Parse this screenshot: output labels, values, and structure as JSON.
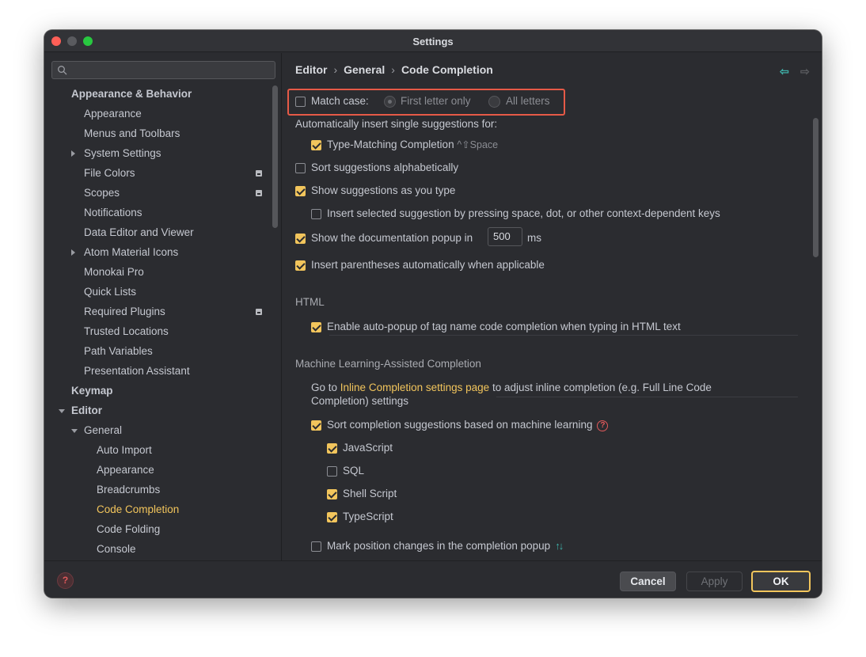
{
  "window": {
    "title": "Settings"
  },
  "sidebar": {
    "search_placeholder": "",
    "items": [
      {
        "label": "Appearance & Behavior",
        "level": 0,
        "bold": true
      },
      {
        "label": "Appearance",
        "level": 1
      },
      {
        "label": "Menus and Toolbars",
        "level": 1
      },
      {
        "label": "System Settings",
        "level": 1,
        "expander": "collapsed"
      },
      {
        "label": "File Colors",
        "level": 1,
        "project_icon": true
      },
      {
        "label": "Scopes",
        "level": 1,
        "project_icon": true
      },
      {
        "label": "Notifications",
        "level": 1
      },
      {
        "label": "Data Editor and Viewer",
        "level": 1
      },
      {
        "label": "Atom Material Icons",
        "level": 1,
        "expander": "collapsed"
      },
      {
        "label": "Monokai Pro",
        "level": 1
      },
      {
        "label": "Quick Lists",
        "level": 1
      },
      {
        "label": "Required Plugins",
        "level": 1,
        "project_icon": true
      },
      {
        "label": "Trusted Locations",
        "level": 1
      },
      {
        "label": "Path Variables",
        "level": 1
      },
      {
        "label": "Presentation Assistant",
        "level": 1
      },
      {
        "label": "Keymap",
        "level": 0,
        "bold": true
      },
      {
        "label": "Editor",
        "level": 0,
        "bold": true,
        "expander": "expanded"
      },
      {
        "label": "General",
        "level": 1,
        "expander": "expanded"
      },
      {
        "label": "Auto Import",
        "level": 2
      },
      {
        "label": "Appearance",
        "level": 2
      },
      {
        "label": "Breadcrumbs",
        "level": 2
      },
      {
        "label": "Code Completion",
        "level": 2,
        "selected": true
      },
      {
        "label": "Code Folding",
        "level": 2
      },
      {
        "label": "Console",
        "level": 2
      }
    ]
  },
  "breadcrumb": {
    "part1": "Editor",
    "part2": "General",
    "part3": "Code Completion",
    "separator": "›"
  },
  "nav": {
    "back": "⇦",
    "forward": "⇨"
  },
  "match_case": {
    "label": "Match case:",
    "checked": false,
    "option_first": "First letter only",
    "option_all": "All letters",
    "selected": "first"
  },
  "auto_insert": {
    "heading": "Automatically insert single suggestions for:",
    "type_matching_label": "Type-Matching Completion",
    "type_matching_shortcut": "^⇧Space",
    "type_matching_checked": true
  },
  "options": {
    "sort_alpha": {
      "label": "Sort suggestions alphabetically",
      "checked": false
    },
    "show_as_you_type": {
      "label": "Show suggestions as you type",
      "checked": true
    },
    "insert_selected": {
      "label": "Insert selected suggestion by pressing space, dot, or other context-dependent keys",
      "checked": false
    },
    "doc_popup": {
      "label": "Show the documentation popup in",
      "value": "500",
      "unit": "ms",
      "checked": true
    },
    "insert_parens": {
      "label": "Insert parentheses automatically when applicable",
      "checked": true
    }
  },
  "html": {
    "title": "HTML",
    "auto_popup": {
      "label": "Enable auto-popup of tag name code completion when typing in HTML text",
      "checked": true
    }
  },
  "ml": {
    "title": "Machine Learning-Assisted Completion",
    "go_to_prefix": "Go to",
    "link": "Inline Completion settings page",
    "suffix_line1": "to adjust inline completion (e.g. Full Line Code",
    "suffix_line2": "Completion) settings",
    "sort_ml": {
      "label": "Sort completion suggestions based on machine learning",
      "checked": true
    },
    "languages": [
      {
        "label": "JavaScript",
        "checked": true
      },
      {
        "label": "SQL",
        "checked": false
      },
      {
        "label": "Shell Script",
        "checked": true
      },
      {
        "label": "TypeScript",
        "checked": true
      }
    ],
    "mark_position": {
      "label": "Mark position changes in the completion popup",
      "checked": false,
      "icon": "↑↓"
    }
  },
  "footer": {
    "help": "?",
    "cancel": "Cancel",
    "apply": "Apply",
    "ok": "OK"
  },
  "colors": {
    "accent": "#f2c55c",
    "highlight": "#e65a47",
    "teal": "#3fb0a8",
    "background": "#2b2c30"
  }
}
